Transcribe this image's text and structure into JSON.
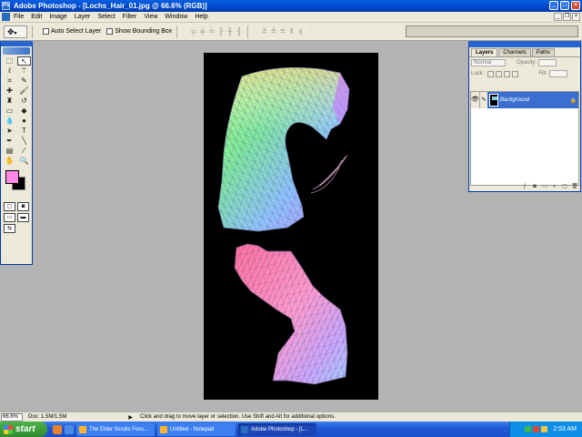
{
  "window": {
    "title": "Adobe Photoshop - [Lochs_Hair_01.jpg @ 66.6% (RGB)]"
  },
  "menu": [
    "File",
    "Edit",
    "Image",
    "Layer",
    "Select",
    "Filter",
    "View",
    "Window",
    "Help"
  ],
  "options": {
    "auto_select_layer": "Auto Select Layer",
    "show_bounding_box": "Show Bounding Box"
  },
  "layers_palette": {
    "tabs": [
      "Layers",
      "Channels",
      "Paths"
    ],
    "blend_mode": "Normal",
    "opacity_label": "Opacity:",
    "fill_label": "Fill:",
    "lock_label": "Lock:",
    "layer_name": "Background"
  },
  "status": {
    "zoom": "66.6%",
    "doc": "Doc: 1.5M/1.5M",
    "hint": "Click and drag to move layer or selection. Use Shift and Alt for additional options."
  },
  "taskbar": {
    "start_label": "start",
    "tasks": [
      "The Elder Scrolls Foru...",
      "Untitled - Notepad",
      "Adobe Photoshop - [L..."
    ],
    "clock": "2:53 AM"
  },
  "colors": {
    "foreground": "#ff88e8",
    "background": "#000000",
    "title_bar": "#0046c8",
    "taskbar": "#2158d8"
  }
}
